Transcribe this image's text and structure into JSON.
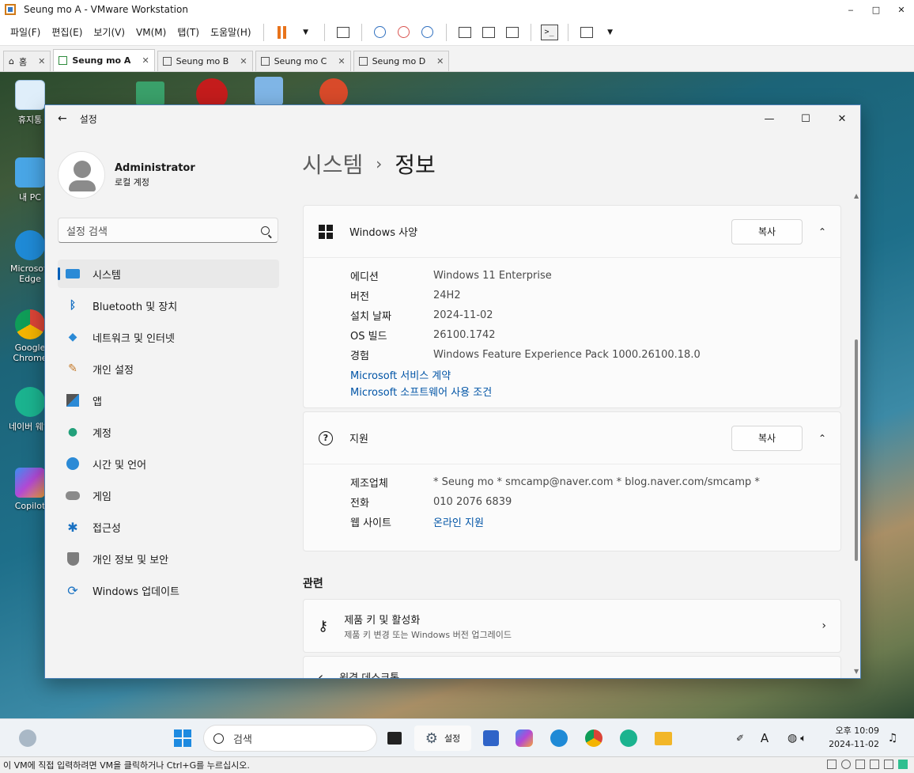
{
  "vmware": {
    "title": "Seung mo A - VMware Workstation",
    "menu": [
      "파일(F)",
      "편집(E)",
      "보기(V)",
      "VM(M)",
      "탭(T)",
      "도움말(H)"
    ],
    "tabs": [
      {
        "label": "홈",
        "active": false
      },
      {
        "label": "Seung mo A",
        "active": true
      },
      {
        "label": "Seung mo B",
        "active": false
      },
      {
        "label": "Seung mo C",
        "active": false
      },
      {
        "label": "Seung mo D",
        "active": false
      }
    ],
    "status_text": "이 VM에 직접 입력하려면 VM을 클릭하거나 Ctrl+G를 누르십시오."
  },
  "desktop_icons": [
    {
      "label": "휴지통",
      "icon": "recycle-bin-icon"
    },
    {
      "label": "내 PC",
      "icon": "pc-icon"
    },
    {
      "label": "Microsoft Edge",
      "icon": "edge-icon"
    },
    {
      "label": "Google Chrome",
      "icon": "chrome-icon"
    },
    {
      "label": "네이버 웨일",
      "icon": "whale-icon"
    },
    {
      "label": "Copilot",
      "icon": "copilot-icon"
    }
  ],
  "settings": {
    "window_label": "설정",
    "user": {
      "name": "Administrator",
      "type": "로컬 계정"
    },
    "search_placeholder": "설정 검색",
    "nav": [
      {
        "label": "시스템",
        "icon": "monitor-icon",
        "active": true
      },
      {
        "label": "Bluetooth 및 장치",
        "icon": "bluetooth-icon"
      },
      {
        "label": "네트워크 및 인터넷",
        "icon": "wifi-icon"
      },
      {
        "label": "개인 설정",
        "icon": "brush-icon"
      },
      {
        "label": "앱",
        "icon": "apps-icon"
      },
      {
        "label": "계정",
        "icon": "person-icon"
      },
      {
        "label": "시간 및 언어",
        "icon": "globe-clock-icon"
      },
      {
        "label": "게임",
        "icon": "gamepad-icon"
      },
      {
        "label": "접근성",
        "icon": "accessibility-icon"
      },
      {
        "label": "개인 정보 및 보안",
        "icon": "shield-icon"
      },
      {
        "label": "Windows 업데이트",
        "icon": "update-icon"
      }
    ],
    "breadcrumb": {
      "parent": "시스템",
      "sep": "›",
      "current": "정보"
    },
    "windows_spec": {
      "title": "Windows 사양",
      "copy_label": "복사",
      "rows": [
        {
          "k": "에디션",
          "v": "Windows 11 Enterprise"
        },
        {
          "k": "버전",
          "v": "24H2"
        },
        {
          "k": "설치 날짜",
          "v": "2024-11-02"
        },
        {
          "k": "OS 빌드",
          "v": "26100.1742"
        },
        {
          "k": "경험",
          "v": "Windows Feature Experience Pack 1000.26100.18.0"
        }
      ],
      "links": [
        "Microsoft 서비스 계약",
        "Microsoft 소프트웨어 사용 조건"
      ]
    },
    "support": {
      "title": "지원",
      "copy_label": "복사",
      "rows": [
        {
          "k": "제조업체",
          "v": "* Seung mo * smcamp@naver.com * blog.naver.com/smcamp *"
        },
        {
          "k": "전화",
          "v": "010 2076 6839"
        },
        {
          "k": "웹 사이트",
          "v": "온라인 지원"
        }
      ]
    },
    "related": {
      "heading": "관련",
      "items": [
        {
          "title": "제품 키 및 활성화",
          "sub": "제품 키 변경 또는 Windows 버전 업그레이드"
        },
        {
          "title": "원격 데스크톱",
          "sub": ""
        }
      ]
    }
  },
  "taskbar": {
    "search_placeholder": "검색",
    "settings_label": "설정",
    "time": "오후 10:09",
    "date": "2024-11-02",
    "ime": "A"
  },
  "colors": {
    "accent": "#005fb8",
    "link": "#0054a6",
    "vm_pause": "#e8731b"
  }
}
